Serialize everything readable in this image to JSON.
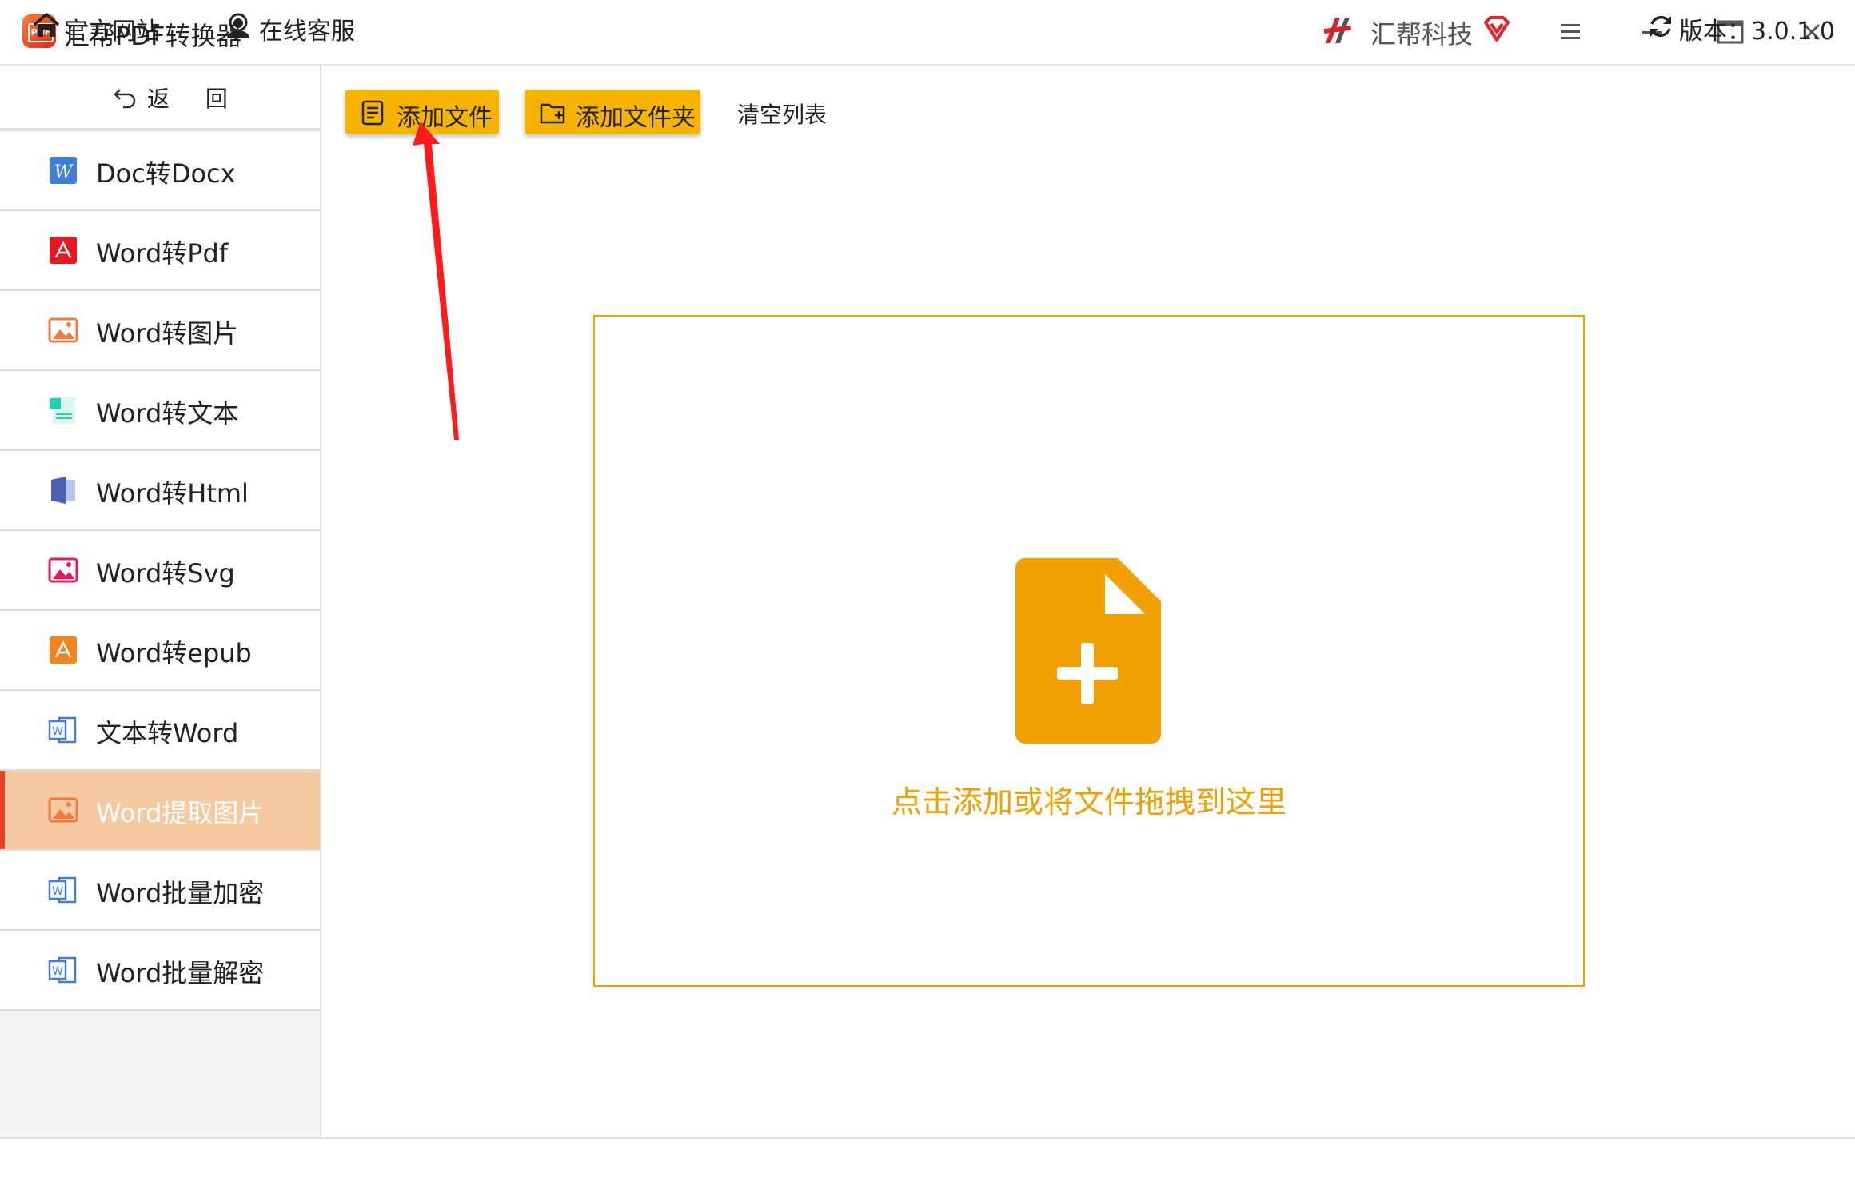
{
  "window": {
    "title": "汇帮PDF转换器",
    "logo_text": "PDF",
    "brand": "汇帮科技"
  },
  "sidebar": {
    "back_label": "返 回",
    "items": [
      {
        "label": "Doc转Docx",
        "icon": "word-w-icon"
      },
      {
        "label": "Word转Pdf",
        "icon": "pdf-icon"
      },
      {
        "label": "Word转图片",
        "icon": "image-icon"
      },
      {
        "label": "Word转文本",
        "icon": "text-doc-icon"
      },
      {
        "label": "Word转Html",
        "icon": "html-icon"
      },
      {
        "label": "Word转Svg",
        "icon": "svg-image-icon"
      },
      {
        "label": "Word转epub",
        "icon": "epub-icon"
      },
      {
        "label": "文本转Word",
        "icon": "word-doc-icon"
      },
      {
        "label": "Word提取图片",
        "icon": "image-icon",
        "active": true
      },
      {
        "label": "Word批量加密",
        "icon": "word-doc-icon"
      },
      {
        "label": "Word批量解密",
        "icon": "word-doc-icon"
      }
    ]
  },
  "toolbar": {
    "add_file": "添加文件",
    "add_folder": "添加文件夹",
    "clear_list": "清空列表"
  },
  "dropzone": {
    "hint": "点击添加或将文件拖拽到这里",
    "icon": "add-file-icon"
  },
  "statusbar": {
    "site": "官方网站",
    "service": "在线客服",
    "version": "版本：3.0.1.0"
  },
  "colors": {
    "accent": "#f6b400",
    "drop_border": "#f0a000",
    "active_item": "#f7c9a1",
    "active_marker": "#e8412a",
    "annotation": "#ff1a1a"
  }
}
